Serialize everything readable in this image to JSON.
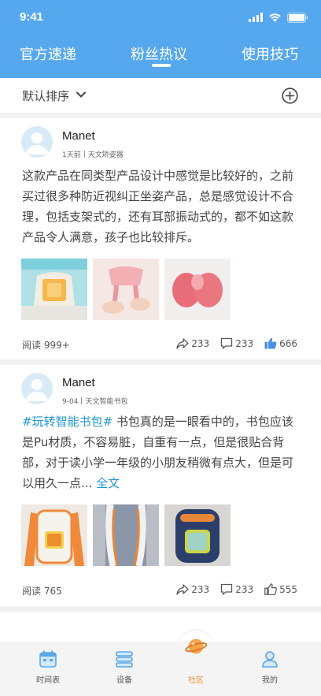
{
  "status_bar": {
    "time": "9:41"
  },
  "tabs": [
    {
      "label": "官方速递",
      "active": false
    },
    {
      "label": "粉丝热议",
      "active": true
    },
    {
      "label": "使用技巧",
      "active": false
    }
  ],
  "sort": {
    "label": "默认排序"
  },
  "posts": [
    {
      "username": "Manet",
      "time": "1天前",
      "source": "天文矫姿器",
      "hashtag": "",
      "text": "这款产品在同类型产品设计中感觉是比较好的，之前买过很多种防近视纠正坐姿产品，总是感觉设计不合理，包括支架式的，还有耳部振动式的，都不如这款产品令人满意，孩子也比较排斥。",
      "more_label": "",
      "read_label": "阅读 999+",
      "shares": "233",
      "comments": "233",
      "likes": "666",
      "liked": true
    },
    {
      "username": "Manet",
      "time": "9-04",
      "source": "天文智能书包",
      "hashtag": "#玩转智能书包#",
      "text": " 书包真的是一眼看中的，书包应该是Pu材质，不容易脏，自重有一点，但是很贴合背部，对于读小学一年级的小朋友稍微有点大，但是可以用久一点...",
      "more_label": " 全文",
      "read_label": "阅读 765",
      "shares": "233",
      "comments": "233",
      "likes": "555",
      "liked": false
    }
  ],
  "bottom_nav": [
    {
      "label": "时间表",
      "icon": "calendar-icon",
      "active": false
    },
    {
      "label": "设备",
      "icon": "device-icon",
      "active": false
    },
    {
      "label": "社区",
      "icon": "planet-icon",
      "active": true
    },
    {
      "label": "我的",
      "icon": "profile-icon",
      "active": false
    }
  ],
  "colors": {
    "header": "#56a8ee",
    "link": "#1e98d4",
    "active_nav": "#f08a2c",
    "like": "#4a90e2"
  }
}
